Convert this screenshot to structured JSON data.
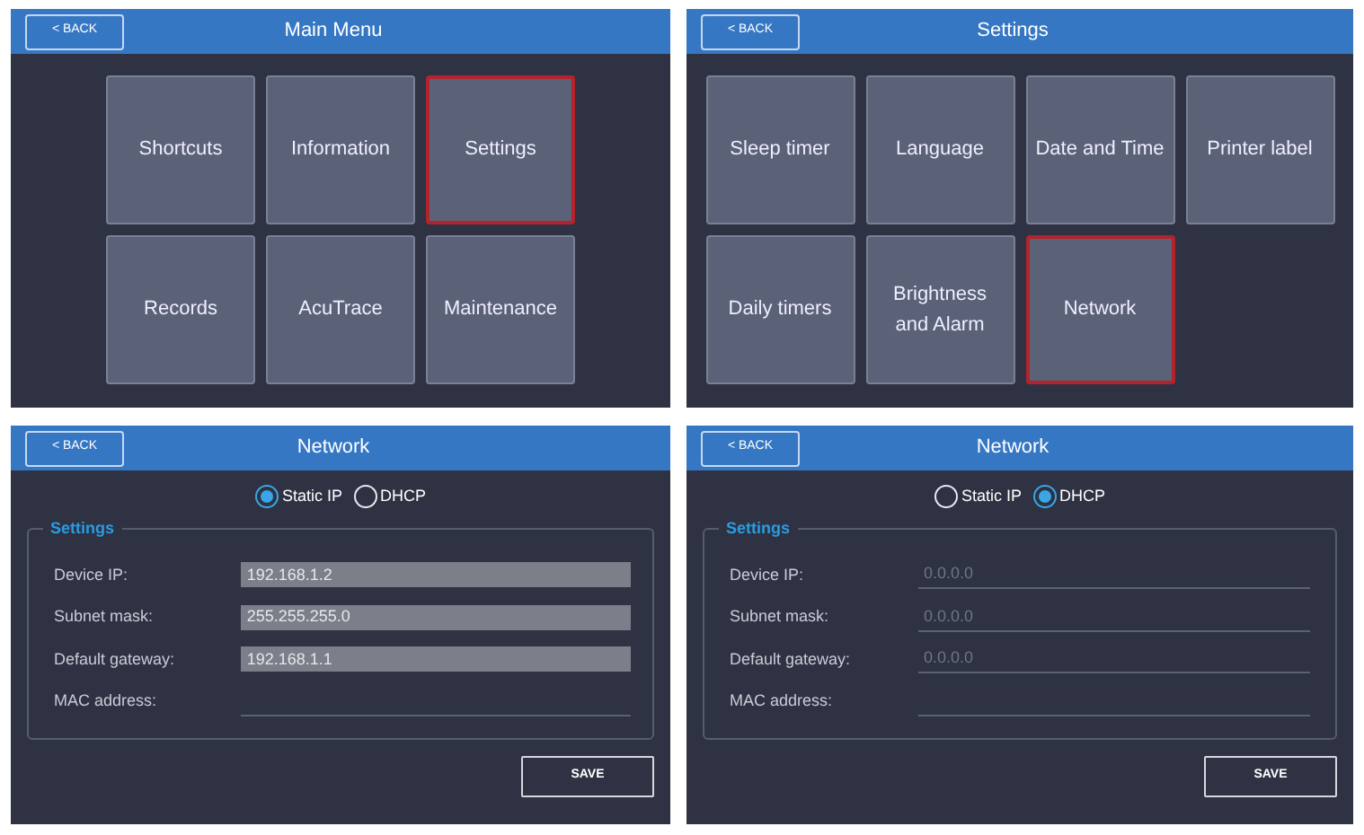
{
  "screens": [
    {
      "kind": "menu",
      "back": "< BACK",
      "title": "Main Menu",
      "tiles": [
        {
          "label": "Shortcuts",
          "selected": false
        },
        {
          "label": "Information",
          "selected": false
        },
        {
          "label": "Settings",
          "selected": true
        },
        {
          "label": "Records",
          "selected": false
        },
        {
          "label": "AcuTrace",
          "selected": false
        },
        {
          "label": "Maintenance",
          "selected": false
        }
      ]
    },
    {
      "kind": "menu",
      "back": "< BACK",
      "title": "Settings",
      "tiles": [
        {
          "label": "Sleep timer",
          "selected": false
        },
        {
          "label": "Language",
          "selected": false
        },
        {
          "label": "Date and Time",
          "selected": false
        },
        {
          "label": "Printer label",
          "selected": false
        },
        {
          "label": "Daily timers",
          "selected": false
        },
        {
          "label": "Brightness and Alarm",
          "selected": false
        },
        {
          "label": "Network",
          "selected": true
        }
      ]
    },
    {
      "kind": "network",
      "back": "< BACK",
      "title": "Network",
      "modes": [
        {
          "label": "Static IP",
          "selected": true
        },
        {
          "label": "DHCP",
          "selected": false
        }
      ],
      "group_title": "Settings",
      "fields": [
        {
          "label": "Device IP:",
          "value": "192.168.1.2",
          "editable": true
        },
        {
          "label": "Subnet mask:",
          "value": "255.255.255.0",
          "editable": true
        },
        {
          "label": "Default gateway:",
          "value": "192.168.1.1",
          "editable": true
        },
        {
          "label": "MAC address:",
          "editable": false
        }
      ],
      "save": "SAVE"
    },
    {
      "kind": "network",
      "back": "< BACK",
      "title": "Network",
      "modes": [
        {
          "label": "Static IP",
          "selected": false
        },
        {
          "label": "DHCP",
          "selected": true
        }
      ],
      "group_title": "Settings",
      "fields": [
        {
          "label": "Device IP:",
          "value": "0.0.0.0",
          "editable": false
        },
        {
          "label": "Subnet mask:",
          "value": "0.0.0.0",
          "editable": false
        },
        {
          "label": "Default gateway:",
          "value": "0.0.0.0",
          "editable": false
        },
        {
          "label": "MAC address:",
          "editable": false
        }
      ],
      "save": "SAVE"
    }
  ]
}
